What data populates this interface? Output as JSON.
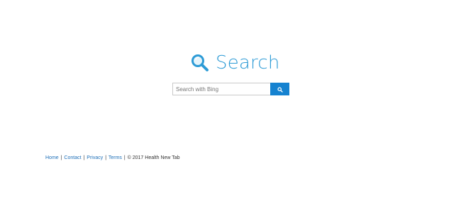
{
  "logo": {
    "text": "Search",
    "icon": "magnifier-icon",
    "color": "#2d9bd6"
  },
  "search": {
    "placeholder": "Search with Bing",
    "value": "",
    "button_icon": "search-icon",
    "button_color": "#1582d0"
  },
  "footer": {
    "links": {
      "home": "Home",
      "contact": "Contact",
      "privacy": "Privacy",
      "terms": "Terms"
    },
    "separator": "|",
    "copyright": "© 2017 Health New Tab"
  }
}
